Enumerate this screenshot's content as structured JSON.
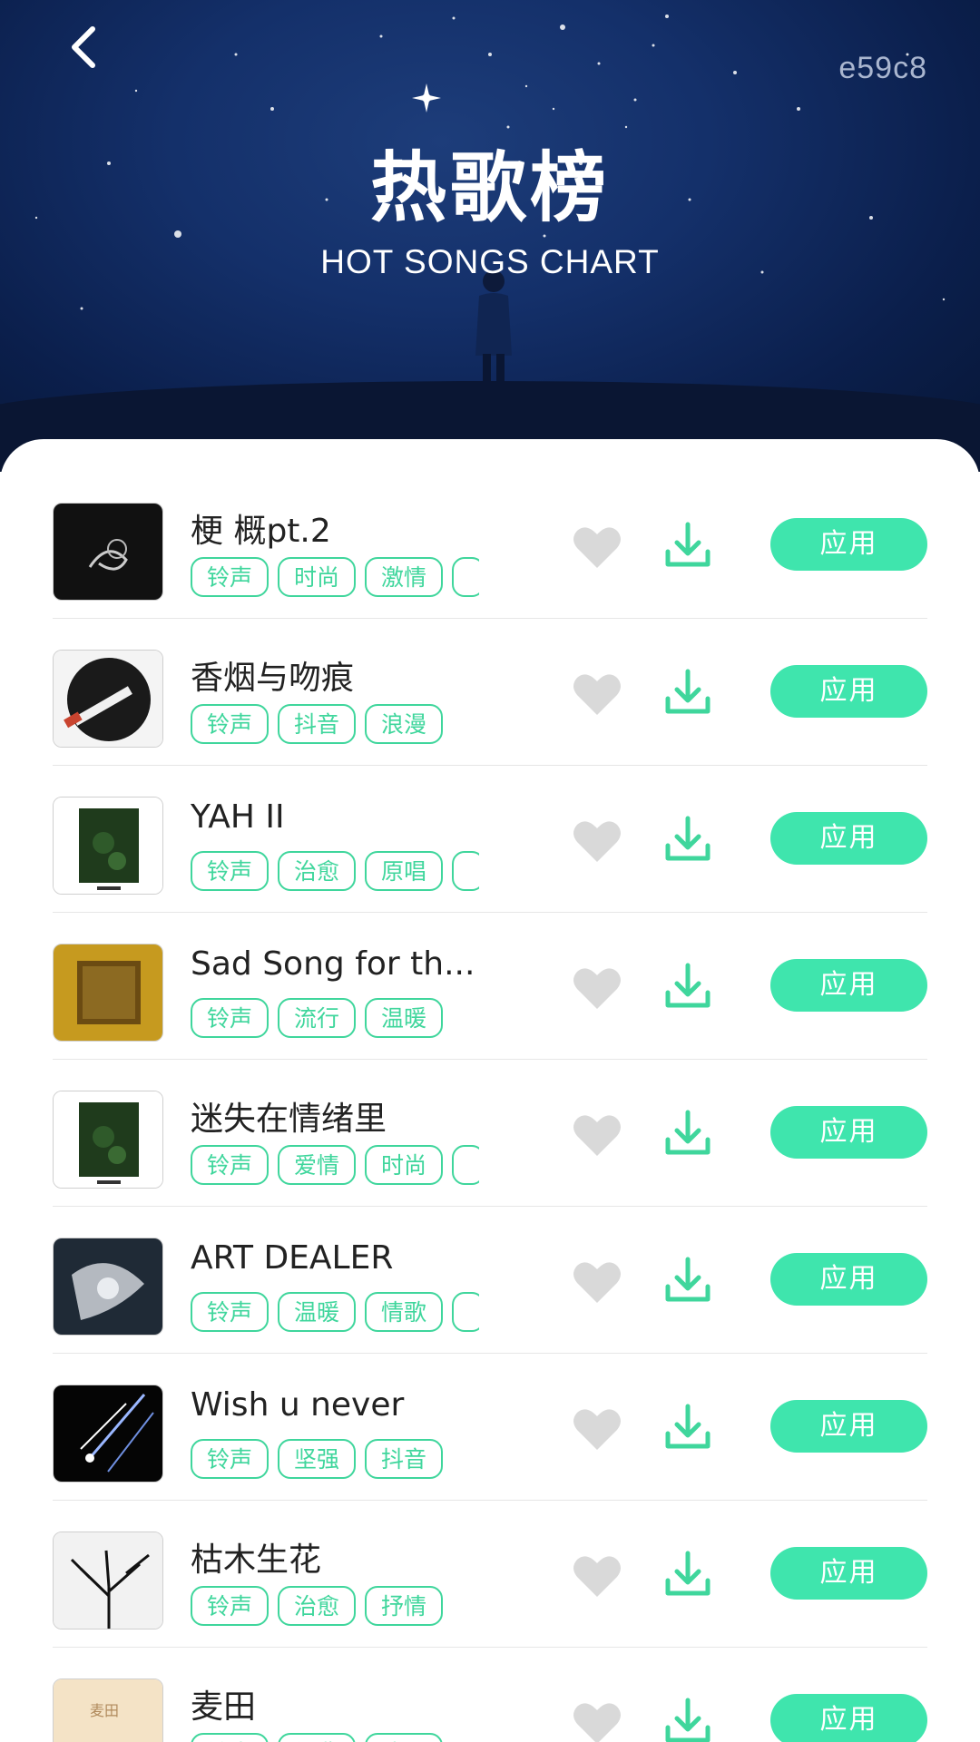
{
  "header": {
    "back_label": "返回",
    "code": "e59c8",
    "title_cn": "热歌榜",
    "title_en": "HOT SONGS CHART"
  },
  "colors": {
    "accent": "#3fe5ad",
    "tag": "#3fd69c",
    "heart": "#d9d9d9",
    "hero_bg": "#14306a"
  },
  "songs": [
    {
      "title": "梗 概pt.2",
      "tags": [
        "铃声",
        "时尚",
        "激情",
        ""
      ],
      "apply_label": "应用",
      "cover_icon": "smoke-cover"
    },
    {
      "title": "香烟与吻痕",
      "tags": [
        "铃声",
        "抖音",
        "浪漫"
      ],
      "apply_label": "应用",
      "cover_icon": "cigarette-cover"
    },
    {
      "title": "YAH II",
      "tags": [
        "铃声",
        "治愈",
        "原唱",
        ""
      ],
      "apply_label": "应用",
      "cover_icon": "forest-cover"
    },
    {
      "title": "Sad Song for th...",
      "tags": [
        "铃声",
        "流行",
        "温暖"
      ],
      "apply_label": "应用",
      "cover_icon": "gold-cover"
    },
    {
      "title": "迷失在情绪里",
      "tags": [
        "铃声",
        "爱情",
        "时尚",
        ""
      ],
      "apply_label": "应用",
      "cover_icon": "forest-cover"
    },
    {
      "title": "ART DEALER",
      "tags": [
        "铃声",
        "温暖",
        "情歌",
        ""
      ],
      "apply_label": "应用",
      "cover_icon": "angel-cover"
    },
    {
      "title": "Wish u never",
      "tags": [
        "铃声",
        "坚强",
        "抖音"
      ],
      "apply_label": "应用",
      "cover_icon": "meteor-cover"
    },
    {
      "title": "枯木生花",
      "tags": [
        "铃声",
        "治愈",
        "抒情"
      ],
      "apply_label": "应用",
      "cover_icon": "tree-cover"
    },
    {
      "title": "麦田",
      "tags": [
        "铃声",
        "经典",
        "浪漫"
      ],
      "apply_label": "应用",
      "cover_icon": "field-cover"
    }
  ]
}
